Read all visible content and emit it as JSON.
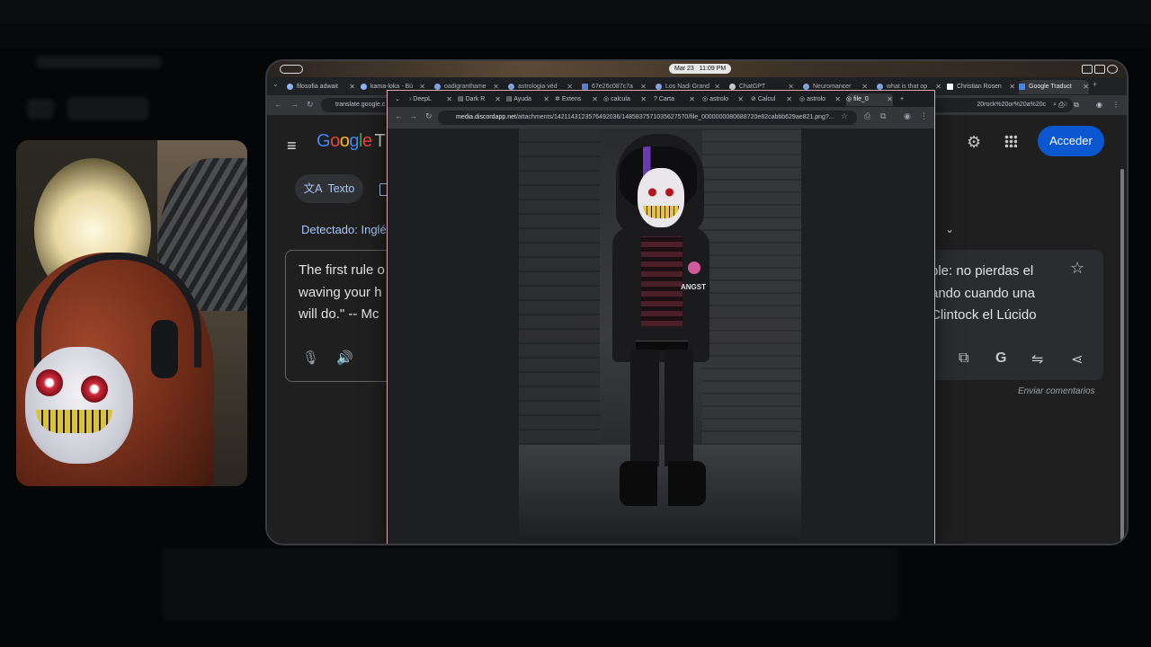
{
  "clock": {
    "date": "Mar 23",
    "time": "11:09 PM"
  },
  "main_browser": {
    "tabs": [
      {
        "label": "filosofia adwait"
      },
      {
        "label": "kama-loka - Bú"
      },
      {
        "label": "oadigranthame"
      },
      {
        "label": "astrologia véd"
      },
      {
        "label": "67e26c087c7a"
      },
      {
        "label": "Los Nadi Grand"
      },
      {
        "label": "ChatGPT"
      },
      {
        "label": "Neuromancer"
      },
      {
        "label": "what is that op"
      },
      {
        "label": "Christian Rosen"
      },
      {
        "label": "Google Traduct"
      }
    ],
    "url_left": "translate.google.c",
    "url_right": "20rock%20or%20a%20c",
    "translate": {
      "logo_g": "G",
      "logo_o1": "o",
      "logo_o2": "o",
      "logo_g2": "g",
      "logo_l": "l",
      "logo_e": "e",
      "logo_t": "T",
      "signin": "Acceder",
      "mode_text": "Texto",
      "detected": "Detectado: Inglé",
      "source_lines": [
        "The first rule o",
        "waving your h",
        "will do.\" -- Mc"
      ],
      "target_lines": [
        "ple: no pierdas el",
        "ando cuando una",
        "Clintock el Lúcido"
      ],
      "feedback": "Enviar comentarios"
    }
  },
  "popup_browser": {
    "tabs": [
      {
        "label": "DeepL"
      },
      {
        "label": "Dark R"
      },
      {
        "label": "Ayuda"
      },
      {
        "label": "Extens"
      },
      {
        "label": "calcula"
      },
      {
        "label": "Carta"
      },
      {
        "label": "astrolo"
      },
      {
        "label": "Calcul"
      },
      {
        "label": "astrolo"
      },
      {
        "label": "file_0"
      }
    ],
    "url_host": "media.discordapp.net",
    "url_path": "/attachments/1421143123576492036/1485837571035627570/file_0000000080688720e82cabbb629ae821.png?...",
    "image_caption": "ANGST"
  }
}
